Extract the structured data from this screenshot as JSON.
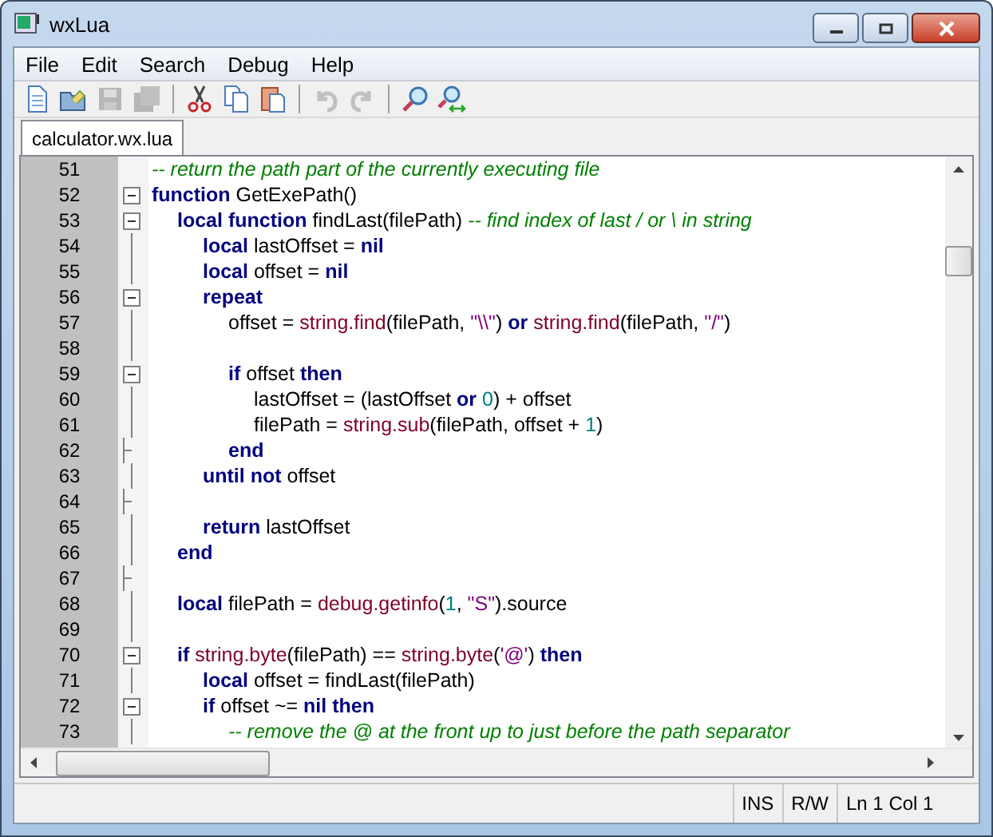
{
  "window": {
    "title": "wxLua"
  },
  "menu": [
    "File",
    "Edit",
    "Search",
    "Debug",
    "Help"
  ],
  "toolbar": [
    {
      "kind": "new",
      "disabled": false
    },
    {
      "kind": "open",
      "disabled": false
    },
    {
      "kind": "save",
      "disabled": true
    },
    {
      "kind": "save-all",
      "disabled": true
    },
    {
      "kind": "sep"
    },
    {
      "kind": "cut",
      "disabled": false
    },
    {
      "kind": "copy",
      "disabled": false
    },
    {
      "kind": "paste",
      "disabled": false
    },
    {
      "kind": "sep"
    },
    {
      "kind": "undo",
      "disabled": true
    },
    {
      "kind": "redo",
      "disabled": true
    },
    {
      "kind": "sep"
    },
    {
      "kind": "find",
      "disabled": false
    },
    {
      "kind": "replace",
      "disabled": false
    }
  ],
  "tabs": [
    {
      "label": "calculator.wx.lua",
      "selected": true
    }
  ],
  "editor": {
    "lines": [
      {
        "number": "51",
        "tokens": [
          {
            "kind": "comment",
            "text": "-- return the path part of the currently executing file"
          }
        ]
      },
      {
        "number": "52",
        "collapsible": true,
        "tokens": [
          {
            "kind": "keyword",
            "text": "function"
          },
          {
            "kind": "plain",
            "text": "GetExePath()"
          }
        ],
        "children": [
          {
            "number": "53",
            "collapsible": true,
            "tokens": [
              {
                "kind": "keyword",
                "text": "local function"
              },
              {
                "kind": "plain",
                "text": "findLast(filePath)"
              },
              {
                "kind": "comment",
                "text": "-- find index of last / or \\ in string"
              }
            ],
            "children": [
              {
                "number": "54",
                "tokens": [
                  {
                    "kind": "keyword",
                    "text": "local"
                  },
                  {
                    "kind": "plain",
                    "text": "lastOffset ="
                  },
                  {
                    "kind": "keyword",
                    "text": "nil"
                  }
                ]
              },
              {
                "number": "55",
                "tokens": [
                  {
                    "kind": "keyword",
                    "text": "local"
                  },
                  {
                    "kind": "plain",
                    "text": "offset ="
                  },
                  {
                    "kind": "keyword",
                    "text": "nil"
                  }
                ]
              },
              {
                "number": "56",
                "collapsible": true,
                "tokens": [
                  {
                    "kind": "keyword",
                    "text": "repeat"
                  }
                ],
                "children": [
                  {
                    "number": "57",
                    "tokens": [
                      {
                        "kind": "plain",
                        "text": "offset ="
                      },
                      {
                        "kind": "lib",
                        "text": "string.find"
                      },
                      {
                        "kind": "plain",
                        "text": "(filePath,",
                        "joined": true
                      },
                      {
                        "kind": "string",
                        "text": "\"\\\\\""
                      },
                      {
                        "kind": "plain",
                        "text": ")",
                        "joined": true
                      },
                      {
                        "kind": "keyword",
                        "text": "or"
                      },
                      {
                        "kind": "lib",
                        "text": "string.find"
                      },
                      {
                        "kind": "plain",
                        "text": "(filePath,",
                        "joined": true
                      },
                      {
                        "kind": "string",
                        "text": "\"/\""
                      },
                      {
                        "kind": "plain",
                        "text": ")",
                        "joined": true
                      }
                    ]
                  },
                  {
                    "number": "58"
                  },
                  {
                    "number": "59",
                    "collapsible": true,
                    "tokens": [
                      {
                        "kind": "keyword",
                        "text": "if"
                      },
                      {
                        "kind": "plain",
                        "text": "offset"
                      },
                      {
                        "kind": "keyword",
                        "text": "then"
                      }
                    ],
                    "children": [
                      {
                        "number": "60",
                        "tokens": [
                          {
                            "kind": "plain",
                            "text": "lastOffset = (lastOffset"
                          },
                          {
                            "kind": "keyword",
                            "text": "or"
                          },
                          {
                            "kind": "number",
                            "text": "0"
                          },
                          {
                            "kind": "plain",
                            "text": ") + offset",
                            "joined": true
                          }
                        ]
                      },
                      {
                        "number": "61",
                        "tokens": [
                          {
                            "kind": "plain",
                            "text": "filePath ="
                          },
                          {
                            "kind": "lib",
                            "text": "string.sub"
                          },
                          {
                            "kind": "plain",
                            "text": "(filePath, offset +",
                            "joined": true
                          },
                          {
                            "kind": "number",
                            "text": "1"
                          },
                          {
                            "kind": "plain",
                            "text": ")",
                            "joined": true
                          }
                        ]
                      }
                    ]
                  },
                  {
                    "number": "62",
                    "fold_end": true,
                    "tokens": [
                      {
                        "kind": "keyword",
                        "text": "end"
                      }
                    ]
                  }
                ]
              },
              {
                "number": "63",
                "tokens": [
                  {
                    "kind": "keyword",
                    "text": "until not"
                  },
                  {
                    "kind": "plain",
                    "text": "offset"
                  }
                ]
              },
              {
                "number": "64",
                "fold_end": true
              },
              {
                "number": "65",
                "tokens": [
                  {
                    "kind": "keyword",
                    "text": "return"
                  },
                  {
                    "kind": "plain",
                    "text": "lastOffset"
                  }
                ]
              }
            ]
          },
          {
            "number": "66",
            "tokens": [
              {
                "kind": "keyword",
                "text": "end"
              }
            ]
          },
          {
            "number": "67",
            "fold_end": true
          },
          {
            "number": "68",
            "tokens": [
              {
                "kind": "keyword",
                "text": "local"
              },
              {
                "kind": "plain",
                "text": "filePath ="
              },
              {
                "kind": "lib",
                "text": "debug.getinfo"
              },
              {
                "kind": "plain",
                "text": "(",
                "joined": true
              },
              {
                "kind": "number",
                "text": "1",
                "joined": true
              },
              {
                "kind": "plain",
                "text": ",",
                "joined": true
              },
              {
                "kind": "string",
                "text": "\"S\""
              },
              {
                "kind": "plain",
                "text": ").source",
                "joined": true
              }
            ]
          },
          {
            "number": "69"
          },
          {
            "number": "70",
            "collapsible": true,
            "tokens": [
              {
                "kind": "keyword",
                "text": "if"
              },
              {
                "kind": "lib",
                "text": "string.byte"
              },
              {
                "kind": "plain",
                "text": "(filePath) ==",
                "joined": true
              },
              {
                "kind": "lib",
                "text": "string.byte"
              },
              {
                "kind": "plain",
                "text": "(",
                "joined": true
              },
              {
                "kind": "string",
                "text": "'@'",
                "joined": true
              },
              {
                "kind": "plain",
                "text": ")",
                "joined": true
              },
              {
                "kind": "keyword",
                "text": "then"
              }
            ],
            "children": [
              {
                "number": "71",
                "tokens": [
                  {
                    "kind": "keyword",
                    "text": "local"
                  },
                  {
                    "kind": "plain",
                    "text": "offset = findLast(filePath)"
                  }
                ]
              },
              {
                "number": "72",
                "collapsible": true,
                "tokens": [
                  {
                    "kind": "keyword",
                    "text": "if"
                  },
                  {
                    "kind": "plain",
                    "text": "offset ~="
                  },
                  {
                    "kind": "keyword",
                    "text": "nil then"
                  }
                ],
                "children": [
                  {
                    "number": "73",
                    "tokens": [
                      {
                        "kind": "comment",
                        "text": "-- remove the @ at the front up to just before the path separator"
                      }
                    ]
                  }
                ]
              }
            ]
          }
        ]
      }
    ]
  },
  "status_bar": [
    "INS",
    "R/W",
    "Ln 1 Col 1"
  ]
}
